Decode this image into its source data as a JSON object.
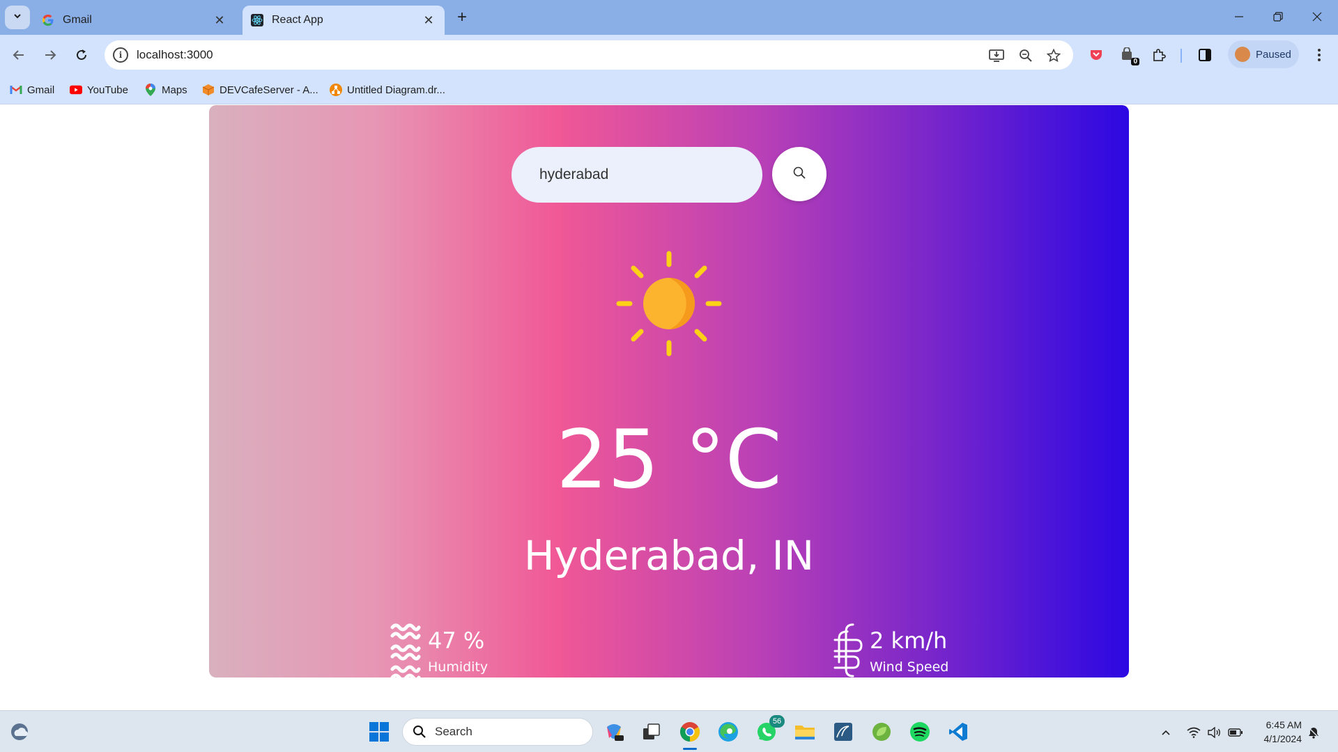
{
  "browser": {
    "tabs": [
      {
        "label": "Gmail",
        "icon": "google-icon"
      },
      {
        "label": "React App",
        "icon": "react-icon"
      }
    ],
    "url": "localhost:3000",
    "profile_label": "Paused",
    "extension_badge": "0",
    "bookmarks": [
      {
        "label": "Gmail",
        "icon": "gmail-icon"
      },
      {
        "label": "YouTube",
        "icon": "youtube-icon"
      },
      {
        "label": "Maps",
        "icon": "maps-icon"
      },
      {
        "label": "DEVCafeServer - A...",
        "icon": "box-icon"
      },
      {
        "label": "Untitled Diagram.dr...",
        "icon": "drawio-icon"
      }
    ]
  },
  "weather": {
    "search_value": "hyderabad",
    "condition_icon": "clear-sun-icon",
    "temperature": "25 °C",
    "city": "Hyderabad, IN",
    "humidity_value": "47 %",
    "humidity_label": "Humidity",
    "wind_value": "2 km/h",
    "wind_label": "Wind Speed",
    "colors": {
      "gradient": [
        "#d9b0be",
        "#f05896",
        "#b940b6",
        "#2c08e2"
      ],
      "sun": "#fbb12a",
      "rays": "#fcd116"
    }
  },
  "taskbar": {
    "search_label": "Search",
    "whatsapp_badge": "56",
    "time": "6:45 AM",
    "date": "4/1/2024"
  }
}
